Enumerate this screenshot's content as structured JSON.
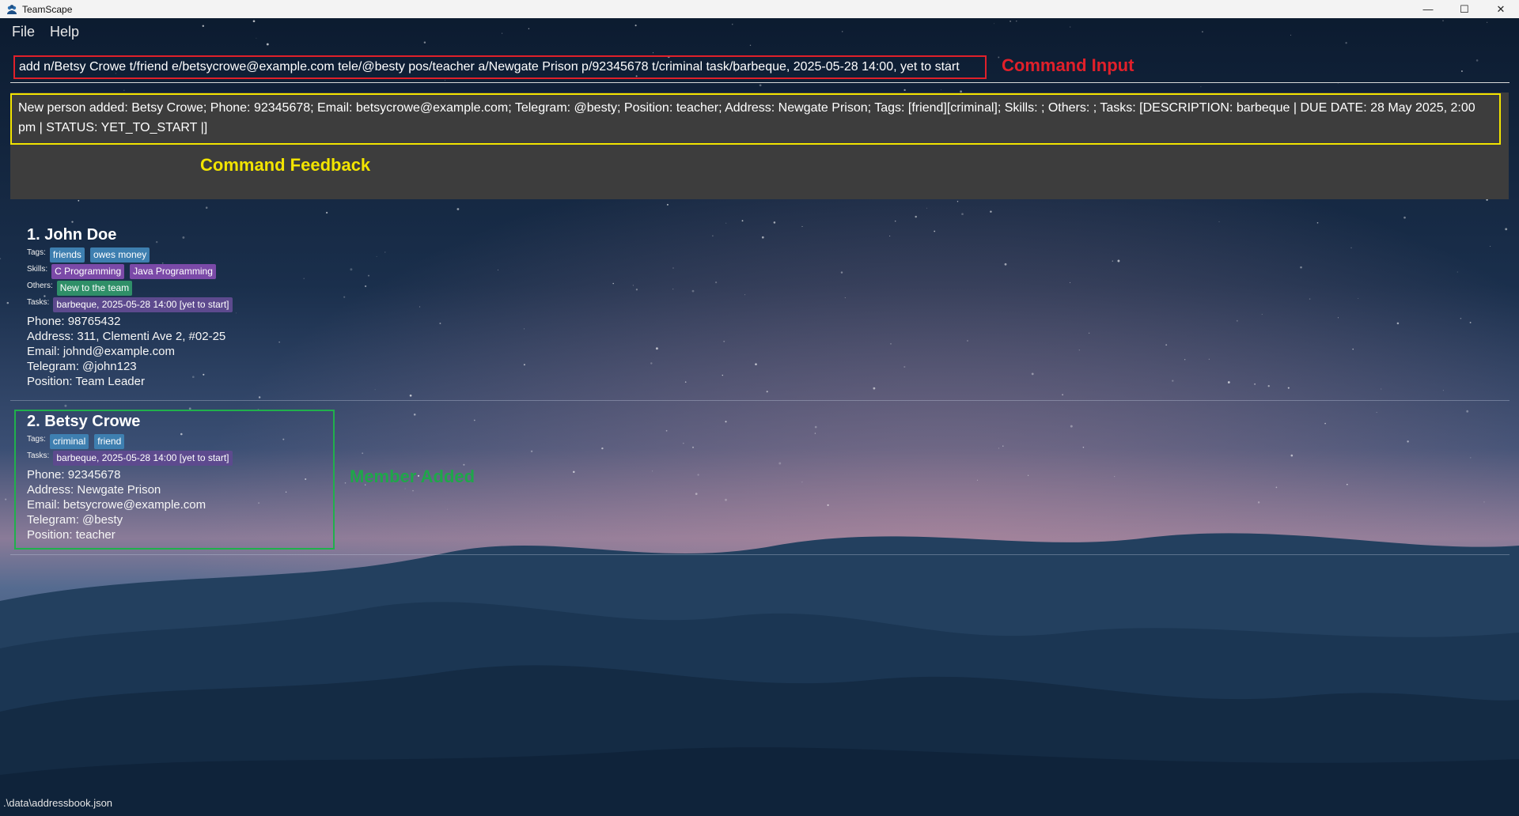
{
  "window": {
    "title": "TeamScape",
    "controls": {
      "minimize": "—",
      "maximize": "☐",
      "close": "✕"
    }
  },
  "menu": {
    "items": [
      "File",
      "Help"
    ]
  },
  "command": {
    "value": "add n/Betsy Crowe t/friend e/betsycrowe@example.com tele/@besty pos/teacher a/Newgate Prison p/92345678 t/criminal task/barbeque, 2025-05-28 14:00, yet to start"
  },
  "annotations": {
    "command_input": "Command Input",
    "command_feedback": "Command Feedback",
    "member_added": "Member Added"
  },
  "feedback": {
    "text": "New person added: Betsy Crowe; Phone: 92345678; Email: betsycrowe@example.com; Telegram: @besty; Position: teacher; Address: Newgate Prison; Tags: [friend][criminal]; Skills: ; Others: ; Tasks: [DESCRIPTION: barbeque | DUE DATE: 28 May 2025, 2:00 pm | STATUS: YET_TO_START |]"
  },
  "labels": {
    "tags": "Tags:",
    "skills": "Skills:",
    "others": "Others:",
    "tasks": "Tasks:"
  },
  "persons": [
    {
      "heading": "1. John Doe",
      "tags": [
        "friends",
        "owes money"
      ],
      "skills": [
        "C Programming",
        "Java Programming"
      ],
      "others": [
        "New to the team"
      ],
      "tasks": [
        "barbeque, 2025-05-28 14:00 [yet to start]"
      ],
      "phone": "Phone: 98765432",
      "address": "Address: 311, Clementi Ave 2, #02-25",
      "email": "Email: johnd@example.com",
      "telegram": "Telegram: @john123",
      "position": "Position: Team Leader"
    },
    {
      "heading": "2. Betsy Crowe",
      "tags": [
        "criminal",
        "friend"
      ],
      "tasks": [
        "barbeque, 2025-05-28 14:00 [yet to start]"
      ],
      "phone": "Phone: 92345678",
      "address": "Address: Newgate Prison",
      "email": "Email: betsycrowe@example.com",
      "telegram": "Telegram: @besty",
      "position": "Position: teacher"
    }
  ],
  "status": {
    "path": ".\\data\\addressbook.json"
  },
  "colors": {
    "command_box": "#e0202a",
    "feedback_box": "#f2e400",
    "member_box": "#20b04c",
    "tag": "#3e7fb0",
    "skill": "#7b4aa8",
    "other": "#2f8f68",
    "task": "#5d4a8e"
  }
}
